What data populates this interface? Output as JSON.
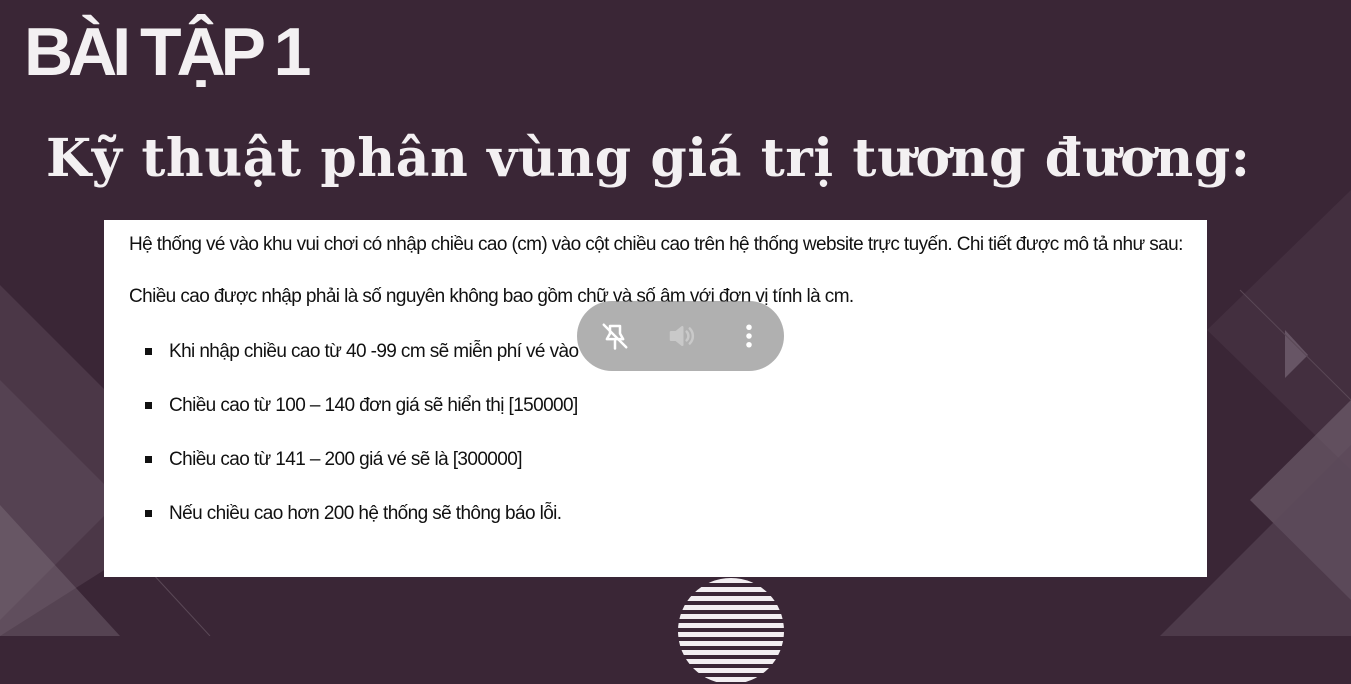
{
  "slide": {
    "heading": "BÀI TẬP 1",
    "subtitle": "Kỹ thuật phân vùng giá trị tương đương:"
  },
  "content": {
    "intro": "Hệ thống vé vào khu vui chơi có nhập chiều cao (cm) vào cột chiều cao trên hệ thống website trực tuyến. Chi tiết được mô tả như sau:",
    "rule": "Chiều cao được nhập phải là số nguyên không bao gồm chữ và số âm với đơn vị tính là cm.",
    "bullets": [
      "Khi nhập chiều cao từ 40 -99 cm sẽ miễn phí vé vào",
      "Chiều cao từ 100 – 140 đơn giá sẽ hiển thị [150000]",
      "Chiều cao từ 141 – 200 giá vé sẽ là [300000]",
      "Nếu chiều cao hơn 200 hệ thống sẽ thông báo lỗi."
    ]
  },
  "overlay": {
    "icons": [
      "pin-off-icon",
      "volume-icon",
      "more-vertical-icon"
    ]
  },
  "theme": {
    "background": "#3a2636",
    "heading_color": "#f3f0f2",
    "content_bg": "#ffffff",
    "overlay_bg": "#808080"
  }
}
